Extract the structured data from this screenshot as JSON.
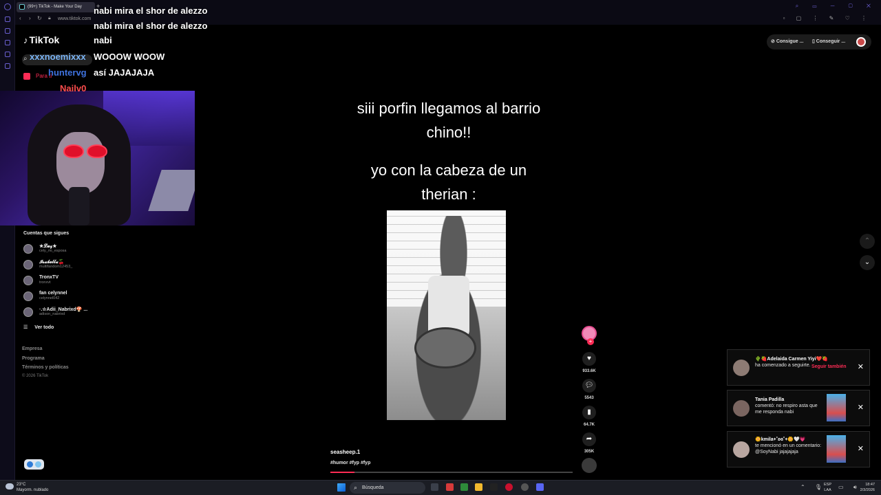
{
  "browser": {
    "tab_title": "(99+) TikTok - Make Your Day",
    "url": "www.tiktok.com"
  },
  "sidebar": {
    "logo": "TikTok",
    "nav_home": "Para ti",
    "following_title": "Cuentas que sigues",
    "following": [
      {
        "name": "★𝓛𝓾𝔃★",
        "user": "cely_mi_esposa"
      },
      {
        "name": "𝓘𝓼𝓪𝓫𝓮𝓵𝓵𝓪🍒",
        "user": "multifandom12453_"
      },
      {
        "name": "TronxTV",
        "user": "tronxvt"
      },
      {
        "name": "fan celynnel",
        "user": "celynnel042"
      },
      {
        "name": "·.☆Adii_Nabrixd🍄 ...",
        "user": "adison_nabrixd"
      }
    ],
    "see_all": "Ver todo",
    "footer_links": [
      "Empresa",
      "Programa",
      "Términos y políticas"
    ],
    "copyright": "© 2026 TikTok"
  },
  "chat": [
    {
      "user": "",
      "msg": "nabi mira el shor de alezzo",
      "color": "#ffffff"
    },
    {
      "user": "",
      "msg": "nabi mira el shor de alezzo",
      "color": "#ffffff"
    },
    {
      "user": "",
      "msg": "nabi",
      "color": "#ffffff"
    },
    {
      "user": "xxxnoemixxx",
      "msg": "WOOOW WOOW",
      "color": "#7ab4f5"
    },
    {
      "user": "huntervg",
      "msg": "así JAJAJAJA",
      "color": "#3f73e0"
    },
    {
      "user": "Nailv0",
      "msg": "",
      "color": "#ff4d4d"
    }
  ],
  "video": {
    "caption_line1": "siii porfin llegamos al barrio",
    "caption_line2": "chino!!",
    "caption_line3": "yo con la cabeza de un",
    "caption_line4": "therian :",
    "author": "seasheep.1",
    "tags": "#humor #fyp #fyp",
    "progress": 0.1
  },
  "actions": {
    "likes": "933.6K",
    "comments": "5543",
    "saves": "64.7K",
    "shares": "305K"
  },
  "top_buttons": {
    "coins": "Consigue ...",
    "app": "Conseguir ..."
  },
  "notifications": [
    {
      "name": "🌵🍓Adelaida Carmen Yiyi❤️🍓",
      "text": "ha comenzado a seguirte.",
      "action": "Seguir también"
    },
    {
      "name": "Tania Padilla",
      "text": "comentó: no respiro asta que me responda nabi"
    },
    {
      "name": "🌼kmila+˚ʚɞ˚+🌼🤍💗",
      "text": "te mencionó en un comentario: @SoyNabi jajajajaja"
    }
  ],
  "taskbar": {
    "temp": "23°C",
    "weather": "Mayorm. nublado",
    "search": "Búsqueda",
    "lang1": "ESP",
    "lang2": "LAA",
    "time": "18:47",
    "date": "2/3/2026"
  }
}
